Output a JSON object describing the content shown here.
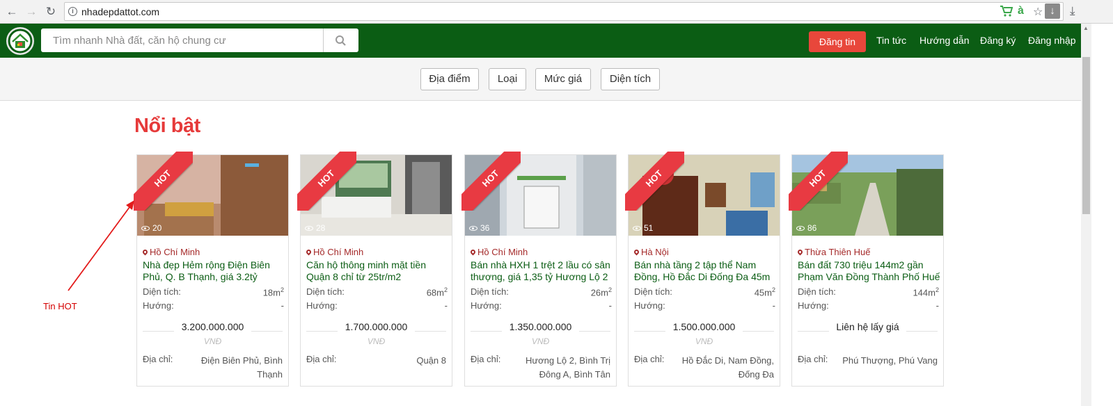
{
  "browser": {
    "url": "nhadepdattot.com"
  },
  "header": {
    "search_placeholder": "Tìm nhanh Nhà đất, căn hộ chung cư",
    "post_button": "Đăng tin",
    "nav": [
      "Tin tức",
      "Hướng dẫn",
      "Đăng ký",
      "Đăng nhập"
    ]
  },
  "filters": [
    "Địa điểm",
    "Loại",
    "Mức giá",
    "Diện tích"
  ],
  "section_title": "Nổi bật",
  "labels": {
    "hot": "HOT",
    "area": "Diện tích:",
    "direction": "Hướng:",
    "address": "Địa chỉ:",
    "unit": "VNĐ"
  },
  "listings": [
    {
      "views": "20",
      "location": "Hồ Chí Minh",
      "title": "Nhà đẹp Hẻm rộng Điện Biên Phủ, Q. B Thạnh, giá 3.2tỷ",
      "area": "18m",
      "direction": "-",
      "price": "3.200.000.000",
      "show_unit": true,
      "address": "Điện Biên Phủ, Bình Thạnh"
    },
    {
      "views": "28",
      "location": "Hồ Chí Minh",
      "title": "Căn hộ thông minh mặt tiền Quận 8 chỉ từ 25tr/m2",
      "area": "68m",
      "direction": "-",
      "price": "1.700.000.000",
      "show_unit": true,
      "address": "Quận 8"
    },
    {
      "views": "36",
      "location": "Hồ Chí Minh",
      "title": "Bán nhà HXH 1 trệt 2 lầu có sân thượng, giá 1,35 tỷ Hương Lộ 2",
      "area": "26m",
      "direction": "-",
      "price": "1.350.000.000",
      "show_unit": true,
      "address": "Hương Lộ 2, Bình Trị Đông A, Bình Tân"
    },
    {
      "views": "51",
      "location": "Hà Nội",
      "title": "Bán nhà tầng 2 tập thể Nam Đồng, Hồ Đắc Di Đống Đa 45m",
      "area": "45m",
      "direction": "-",
      "price": "1.500.000.000",
      "show_unit": true,
      "address": "Hồ Đắc Di, Nam Đồng, Đống Đa"
    },
    {
      "views": "86",
      "location": "Thừa Thiên Huế",
      "title": "Bán đất 730 triệu 144m2 gần Phạm Văn Đồng Thành Phố Huế",
      "area": "144m",
      "direction": "-",
      "price": "Liên hệ lấy giá",
      "show_unit": false,
      "address": "Phú Thượng, Phú Vang"
    }
  ],
  "annotation": "Tin HOT",
  "colors": {
    "header_green": "#0b5d14",
    "post_red": "#e8473b",
    "title_red": "#e63a3a",
    "hot_ribbon": "#e83a42",
    "location_brown": "#a52a2a",
    "listing_title_green": "#0b5d14"
  }
}
